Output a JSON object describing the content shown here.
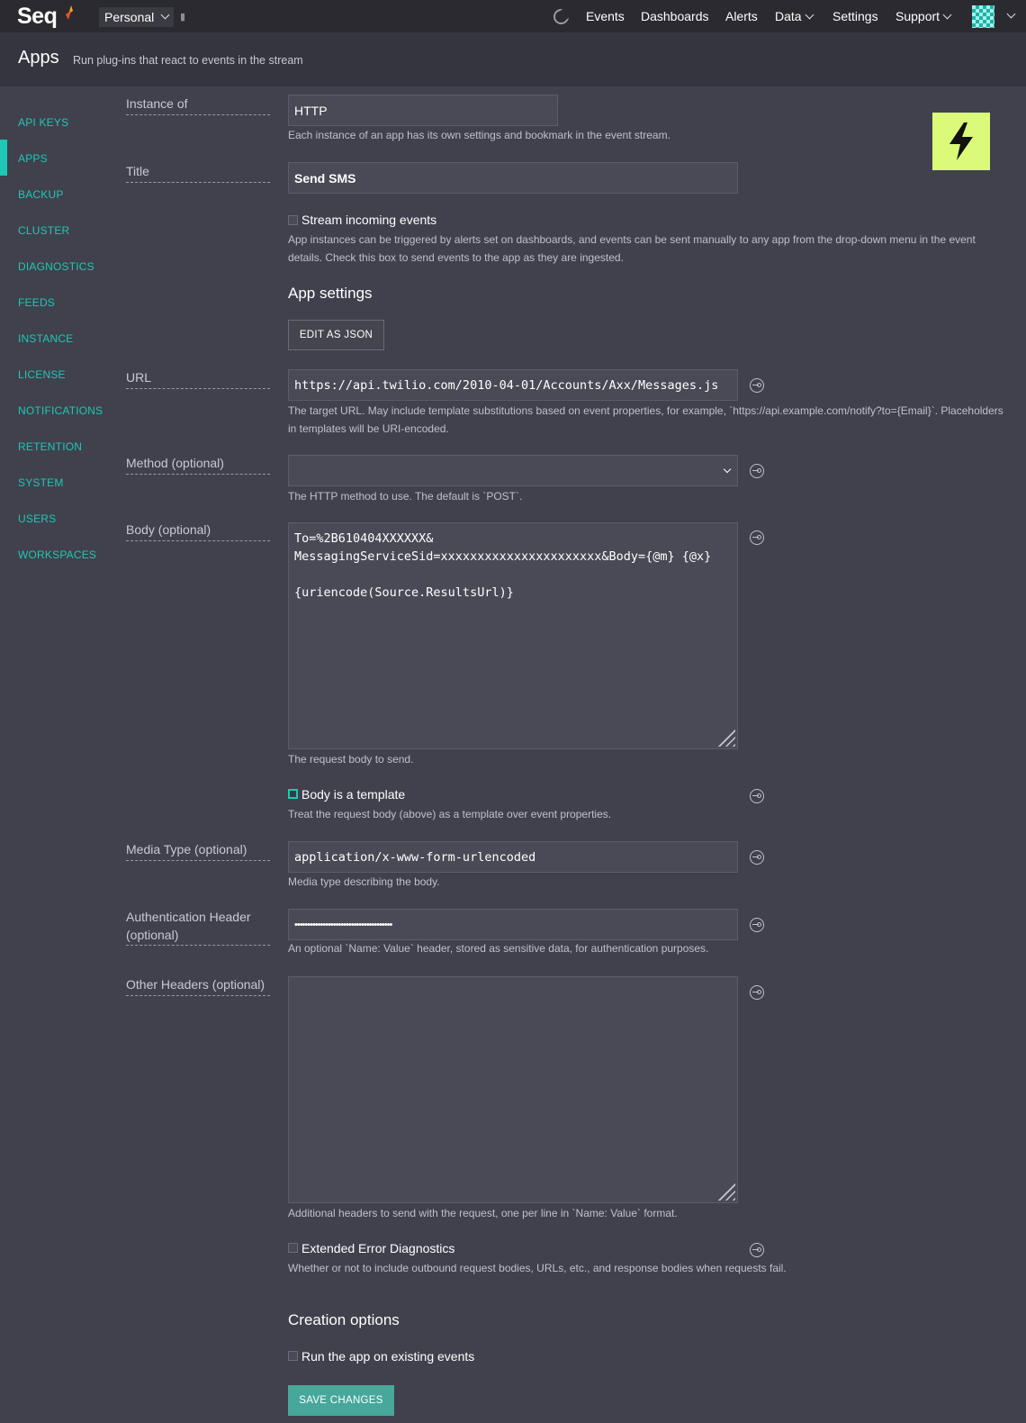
{
  "topbar": {
    "logo": "Seq",
    "workspace": "Personal",
    "nav": [
      "Events",
      "Dashboards",
      "Alerts",
      "Data",
      "Settings",
      "Support"
    ]
  },
  "header": {
    "title": "Apps",
    "subtitle": "Run plug-ins that react to events in the stream"
  },
  "sidebar": {
    "items": [
      "API KEYS",
      "APPS",
      "BACKUP",
      "CLUSTER",
      "DIAGNOSTICS",
      "FEEDS",
      "INSTANCE",
      "LICENSE",
      "NOTIFICATIONS",
      "RETENTION",
      "SYSTEM",
      "USERS",
      "WORKSPACES"
    ],
    "active": "APPS"
  },
  "form": {
    "instance_of": {
      "label": "Instance of",
      "value": "HTTP",
      "help": "Each instance of an app has its own settings and bookmark in the event stream."
    },
    "title": {
      "label": "Title",
      "value": "Send SMS"
    },
    "stream": {
      "label": "Stream incoming events",
      "checked": false,
      "help1": "App instances can be triggered by alerts set on dashboards, and events can be sent manually to any app from the drop-down menu in the event",
      "help2": "details. Check this box to send events to the app as they are ingested."
    },
    "app_settings_heading": "App settings",
    "edit_json_label": "EDIT AS JSON",
    "url": {
      "label": "URL",
      "value": "https://api.twilio.com/2010-04-01/Accounts/Axx/Messages.js",
      "help1": "The target URL. May include template substitutions based on event properties, for example, `https://api.example.com/notify?to={Email}`. Placeholders",
      "help2": "in templates will be URI-encoded."
    },
    "method": {
      "label": "Method (optional)",
      "value": "",
      "help": "The HTTP method to use. The default is `POST`."
    },
    "body": {
      "label": "Body (optional)",
      "value": "To=%2B610404XXXXXX&\nMessagingServiceSid=xxxxxxxxxxxxxxxxxxxxxx&Body={@m} {@x}\n\n{uriencode(Source.ResultsUrl)}",
      "help": "The request body to send."
    },
    "body_template": {
      "label": "Body is a template",
      "checked": true,
      "help": "Treat the request body (above) as a template over event properties."
    },
    "media_type": {
      "label": "Media Type (optional)",
      "value": "application/x-www-form-urlencoded",
      "help": "Media type describing the body."
    },
    "auth_header": {
      "label1": "Authentication Header",
      "label2": "(optional)",
      "value": "••••••••••••••••••••••••••••••••••••••",
      "help": "An optional `Name: Value` header, stored as sensitive data, for authentication purposes."
    },
    "other_headers": {
      "label": "Other Headers (optional)",
      "value": "",
      "help": "Additional headers to send with the request, one per line in `Name: Value` format."
    },
    "extended_errors": {
      "label": "Extended Error Diagnostics",
      "checked": false,
      "help": "Whether or not to include outbound request bodies, URLs, etc., and response bodies when requests fail."
    },
    "creation_heading": "Creation options",
    "run_existing": {
      "label": "Run the app on existing events",
      "checked": false
    },
    "save_label": "SAVE CHANGES"
  },
  "icons": {
    "app": "lightning-bolt-icon",
    "reset": "reset-icon",
    "theme": "moon-icon"
  },
  "colors": {
    "accent": "#1ec8b5",
    "primary_button": "#47a79b",
    "app_icon_bg": "#dcfa7a"
  }
}
